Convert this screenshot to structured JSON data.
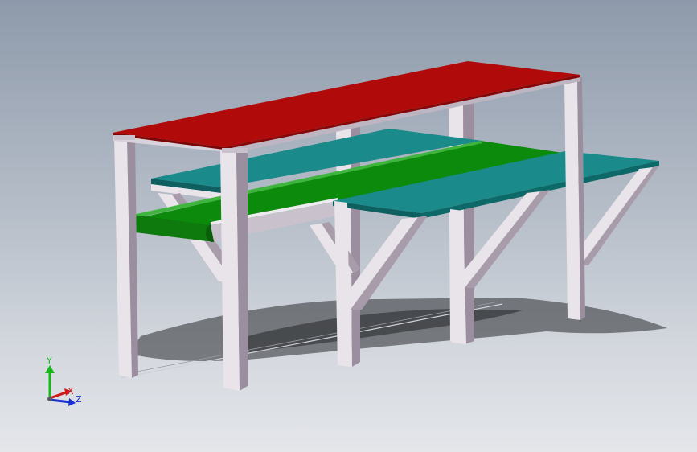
{
  "colors": {
    "background_top": "#8e9aab",
    "background_bottom": "#e4e6ea",
    "top_shelf": "#b00a0a",
    "conveyor_belt": "#0b8a0b",
    "work_surface": "#1b8a8a",
    "frame_light": "#e8e4ea",
    "frame_mid": "#b8b0bc",
    "frame_dark": "#7a6e7e",
    "shadow": "#2a2c30",
    "axis_x": "#d01818",
    "axis_y": "#18b818",
    "axis_z": "#1830d0"
  },
  "triad": {
    "x_label": "X",
    "y_label": "Y",
    "z_label": "Z"
  },
  "watermark": {
    "text": "…"
  }
}
